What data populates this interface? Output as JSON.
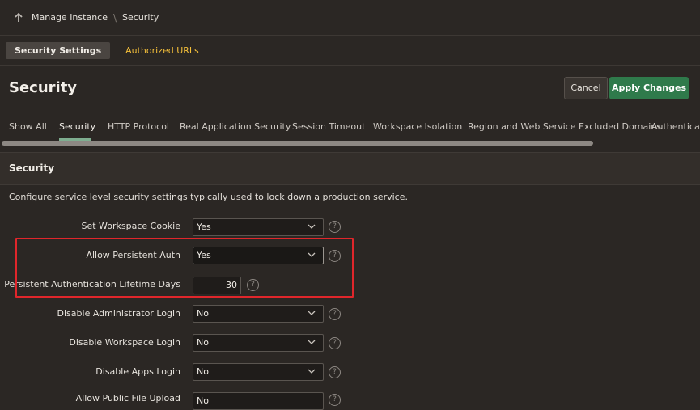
{
  "breadcrumb": {
    "items": [
      "Manage Instance",
      "Security"
    ],
    "separator": "\\"
  },
  "subtabs": [
    {
      "label": "Security Settings",
      "active": true
    },
    {
      "label": "Authorized URLs",
      "active": false
    }
  ],
  "page": {
    "title": "Security",
    "cancel_label": "Cancel",
    "apply_label": "Apply Changes"
  },
  "tabs": [
    {
      "label": "Show All"
    },
    {
      "label": "Security",
      "active": true
    },
    {
      "label": "HTTP Protocol"
    },
    {
      "label": "Real Application Security"
    },
    {
      "label": "Session Timeout"
    },
    {
      "label": "Workspace Isolation"
    },
    {
      "label": "Region and Web Service Excluded Domains"
    },
    {
      "label": "Authentication"
    }
  ],
  "region": {
    "title": "Security",
    "description": "Configure service level security settings typically used to lock down a production service."
  },
  "form": {
    "set_workspace_cookie": {
      "label": "Set Workspace Cookie",
      "value": "Yes"
    },
    "allow_persistent_auth": {
      "label": "Allow Persistent Auth",
      "value": "Yes"
    },
    "persistent_auth_lifetime": {
      "label": "Persistent Authentication Lifetime Days",
      "value": "30"
    },
    "disable_admin_login": {
      "label": "Disable Administrator Login",
      "value": "No"
    },
    "disable_workspace_login": {
      "label": "Disable Workspace Login",
      "value": "No"
    },
    "disable_apps_login": {
      "label": "Disable Apps Login",
      "value": "No"
    },
    "allow_public_file_upload": {
      "label": "Allow Public File Upload",
      "value": "No"
    }
  },
  "help_glyph": "?",
  "colors": {
    "background": "#2b2724",
    "accent_green": "#2f7a4b",
    "link_yellow": "#f4bf3a",
    "highlight_red": "#e0262b"
  }
}
